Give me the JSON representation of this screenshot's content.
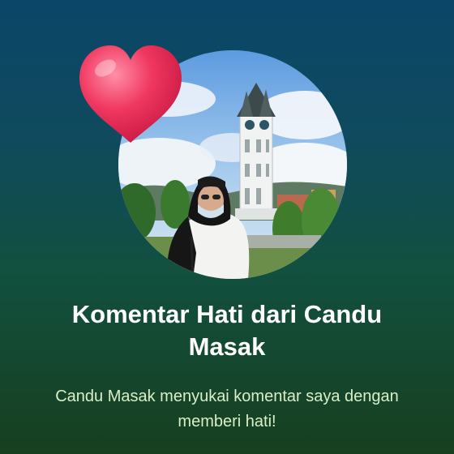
{
  "notification": {
    "title": "Komentar Hati dari Candu Masak",
    "message": "Candu Masak menyukai komentar saya dengan memberi hati!"
  },
  "icons": {
    "heart": "heart-icon"
  },
  "colors": {
    "background_top": "#0b4668",
    "background_bottom": "#173f1f",
    "heart": "#e8325a",
    "title": "#ffffff",
    "message": "#d9eec8"
  }
}
